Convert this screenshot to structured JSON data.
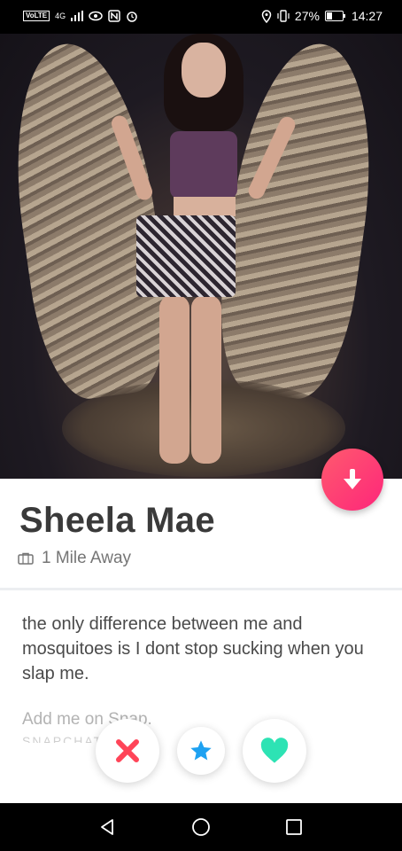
{
  "status_bar": {
    "carrier_badge": "VoLTE",
    "network": "4G",
    "battery": "27%",
    "time": "14:27"
  },
  "profile": {
    "name": "Sheela Mae",
    "distance": "1 Mile Away",
    "bio": "the only difference between me and mosquitoes is I dont stop sucking when you slap me.",
    "bio_extra": "Add me on Snap.",
    "bio_extra_2": "SNAPCHAT"
  },
  "icons": {
    "info_button": "arrow-down-icon",
    "distance": "briefcase-icon",
    "nope": "close-icon",
    "super_like": "star-icon",
    "like": "heart-icon"
  },
  "colors": {
    "accent": "#fd267a",
    "nope": "#ff4458",
    "super_like": "#1ea1f1",
    "like": "#2de3b4"
  }
}
